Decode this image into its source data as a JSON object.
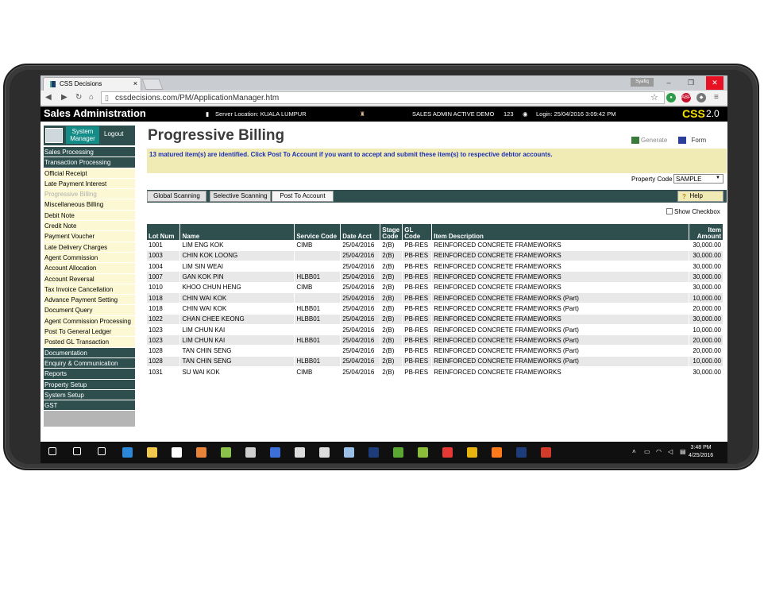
{
  "browser": {
    "tab_title": "CSS Decisions",
    "tab_close": "×",
    "user_badge": "Syafiq",
    "url": "cssdecisions.com/PM/ApplicationManager.htm",
    "controls": {
      "minimize": "–",
      "restore": "❐",
      "close": "✕"
    },
    "ext_abp": "ABP"
  },
  "app_header": {
    "title": "Sales Administration",
    "server": "Server Location: KUALA LUMPUR",
    "demo": "SALES ADMIN ACTIVE DEMO",
    "count": "123",
    "login": "Login: 25/04/2016 3:09:42 PM",
    "logo": "CSS",
    "version": "2.0"
  },
  "sidebar": {
    "system_manager": "System Manager",
    "logout": "Logout",
    "items": [
      {
        "label": "Sales Processing",
        "style": "head"
      },
      {
        "label": "Transaction Processing",
        "style": "head"
      },
      {
        "label": "Official Receipt",
        "style": "item"
      },
      {
        "label": "Late Payment Interest",
        "style": "item"
      },
      {
        "label": "Progressive Billing",
        "style": "dim"
      },
      {
        "label": "Miscellaneous Billing",
        "style": "item"
      },
      {
        "label": "Debit Note",
        "style": "item"
      },
      {
        "label": "Credit Note",
        "style": "item"
      },
      {
        "label": "Payment Voucher",
        "style": "item"
      },
      {
        "label": "Late Delivery Charges",
        "style": "item"
      },
      {
        "label": "Agent Commission",
        "style": "item"
      },
      {
        "label": "Account Allocation",
        "style": "item"
      },
      {
        "label": "Account Reversal",
        "style": "item"
      },
      {
        "label": "Tax Invoice Cancellation",
        "style": "item"
      },
      {
        "label": "Advance Payment Setting",
        "style": "item"
      },
      {
        "label": "Document Query",
        "style": "item"
      },
      {
        "label": "Agent Commission Processing",
        "style": "item"
      },
      {
        "label": "Post To General Ledger",
        "style": "item"
      },
      {
        "label": "Posted GL Transaction",
        "style": "item"
      },
      {
        "label": "Documentation",
        "style": "head"
      },
      {
        "label": "Enquiry & Communication",
        "style": "head"
      },
      {
        "label": "Reports",
        "style": "head"
      },
      {
        "label": "Property Setup",
        "style": "head"
      },
      {
        "label": "System Setup",
        "style": "head"
      },
      {
        "label": "GST",
        "style": "head"
      }
    ]
  },
  "main": {
    "title": "Progressive Billing",
    "generate": "Generate",
    "form": "Form",
    "message": "13 matured item(s) are identified. Click Post To Account if you want to accept and submit these item(s) to respective debtor accounts.",
    "property_code_label": "Property Code",
    "property_code_value": "SAMPLE",
    "buttons": {
      "global": "Global Scanning",
      "selective": "Selective Scanning",
      "post": "Post To Account",
      "help": "Help"
    },
    "show_checkbox": "Show Checkbox"
  },
  "table": {
    "headers": {
      "lot": "Lot Num",
      "name": "Name",
      "service": "Service Code",
      "date": "Date Acct",
      "stage": "Stage Code",
      "gl": "GL Code",
      "desc": "Item Description",
      "amount": "Item Amount"
    },
    "rows": [
      [
        "1001",
        "LIM ENG KOK",
        "CIMB",
        "25/04/2016",
        "2(B)",
        "PB-RES",
        "REINFORCED CONCRETE FRAMEWORKS",
        "30,000.00"
      ],
      [
        "1003",
        "CHIN KOK LOONG",
        "",
        "25/04/2016",
        "2(B)",
        "PB-RES",
        "REINFORCED CONCRETE FRAMEWORKS",
        "30,000.00"
      ],
      [
        "1004",
        "LIM SIN WEAI",
        "",
        "25/04/2016",
        "2(B)",
        "PB-RES",
        "REINFORCED CONCRETE FRAMEWORKS",
        "30,000.00"
      ],
      [
        "1007",
        "GAN KOK PIN",
        "HLBB01",
        "25/04/2016",
        "2(B)",
        "PB-RES",
        "REINFORCED CONCRETE FRAMEWORKS",
        "30,000.00"
      ],
      [
        "1010",
        "KHOO CHUN HENG",
        "CIMB",
        "25/04/2016",
        "2(B)",
        "PB-RES",
        "REINFORCED CONCRETE FRAMEWORKS",
        "30,000.00"
      ],
      [
        "1018",
        "CHIN WAI KOK",
        "",
        "25/04/2016",
        "2(B)",
        "PB-RES",
        "REINFORCED CONCRETE FRAMEWORKS (Part)",
        "10,000.00"
      ],
      [
        "1018",
        "CHIN WAI KOK",
        "HLBB01",
        "25/04/2016",
        "2(B)",
        "PB-RES",
        "REINFORCED CONCRETE FRAMEWORKS (Part)",
        "20,000.00"
      ],
      [
        "1022",
        "CHAN CHEE KEONG",
        "HLBB01",
        "25/04/2016",
        "2(B)",
        "PB-RES",
        "REINFORCED CONCRETE FRAMEWORKS",
        "30,000.00"
      ],
      [
        "1023",
        "LIM CHUN KAI",
        "",
        "25/04/2016",
        "2(B)",
        "PB-RES",
        "REINFORCED CONCRETE FRAMEWORKS (Part)",
        "10,000.00"
      ],
      [
        "1023",
        "LIM CHUN KAI",
        "HLBB01",
        "25/04/2016",
        "2(B)",
        "PB-RES",
        "REINFORCED CONCRETE FRAMEWORKS (Part)",
        "20,000.00"
      ],
      [
        "1028",
        "TAN CHIN SENG",
        "",
        "25/04/2016",
        "2(B)",
        "PB-RES",
        "REINFORCED CONCRETE FRAMEWORKS (Part)",
        "20,000.00"
      ],
      [
        "1028",
        "TAN CHIN SENG",
        "HLBB01",
        "25/04/2016",
        "2(B)",
        "PB-RES",
        "REINFORCED CONCRETE FRAMEWORKS (Part)",
        "10,000.00"
      ],
      [
        "1031",
        "SU WAI KOK",
        "CIMB",
        "25/04/2016",
        "2(B)",
        "PB-RES",
        "REINFORCED CONCRETE FRAMEWORKS",
        "30,000.00"
      ]
    ]
  },
  "taskbar": {
    "time": "3:48 PM",
    "date": "4/25/2016",
    "icons": [
      "start-icon",
      "search-icon",
      "task-view-icon",
      "edge-icon",
      "file-explorer-icon",
      "store-icon",
      "app-orange-icon",
      "notepad-icon",
      "tools-icon",
      "link-icon",
      "media-icon",
      "calculator-icon",
      "notes-icon",
      "photoshop-icon",
      "android-icon",
      "layers-icon",
      "record-icon",
      "chrome-icon",
      "firefox-icon",
      "photoshop-2-icon",
      "powerpoint-icon"
    ],
    "colors": {
      "accent": "#2f4f4f",
      "message_bg": "#f0eab5",
      "message_text": "#1a2fb6"
    }
  }
}
